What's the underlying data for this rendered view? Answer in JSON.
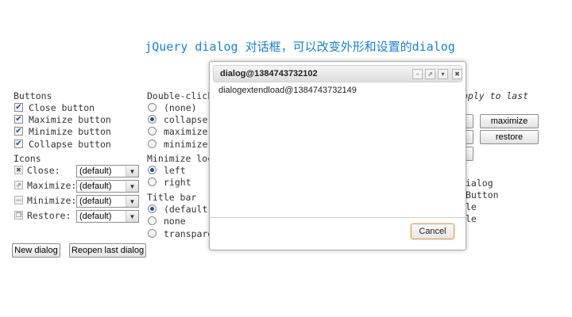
{
  "page_title": "jQuery dialog 对话框，可以改变外形和设置的dialog",
  "buttons_section": {
    "heading": "Buttons",
    "items": [
      {
        "label": "Close button",
        "checked": true
      },
      {
        "label": "Maximize button",
        "checked": true
      },
      {
        "label": "Minimize button",
        "checked": true
      },
      {
        "label": "Collapse button",
        "checked": true
      }
    ]
  },
  "icons_section": {
    "heading": "Icons",
    "items": [
      {
        "label": "Close:",
        "icon": "close-icon",
        "value": "(default)"
      },
      {
        "label": "Maximize:",
        "icon": "maximize-icon",
        "value": "(default)"
      },
      {
        "label": "Minimize:",
        "icon": "minimize-icon",
        "value": "(default)"
      },
      {
        "label": "Restore:",
        "icon": "restore-icon",
        "value": "(default)"
      }
    ]
  },
  "dblclick_section": {
    "heading": "Double-click",
    "options": [
      {
        "label": "(none)",
        "selected": false
      },
      {
        "label": "collapse",
        "selected": true
      },
      {
        "label": "maximize",
        "selected": false
      },
      {
        "label": "minimize",
        "selected": false
      }
    ]
  },
  "minimize_location": {
    "heading": "Minimize loc",
    "options": [
      {
        "label": "left",
        "selected": true
      },
      {
        "label": "right",
        "selected": false
      }
    ]
  },
  "titlebar_section": {
    "heading": "Title bar",
    "options": [
      {
        "label": "(default)",
        "selected": true
      },
      {
        "label": "none",
        "selected": false
      },
      {
        "label": "transpare",
        "selected": false
      }
    ]
  },
  "apply_to_last": "pply to last",
  "action_buttons": {
    "maximize": "maximize",
    "restore": "restore"
  },
  "right_partial_text": [
    "ialog",
    "Button",
    "le",
    "le"
  ],
  "bottom_buttons": {
    "new_dialog": "New dialog",
    "reopen_last": "Reopen last dialog"
  },
  "dialog": {
    "title": "dialog@1384743732102",
    "content": "dialogextendload@1384743732149",
    "cancel_label": "Cancel"
  },
  "colors": {
    "title": "#1c7fd2",
    "accent_border": "#d4a05e"
  }
}
